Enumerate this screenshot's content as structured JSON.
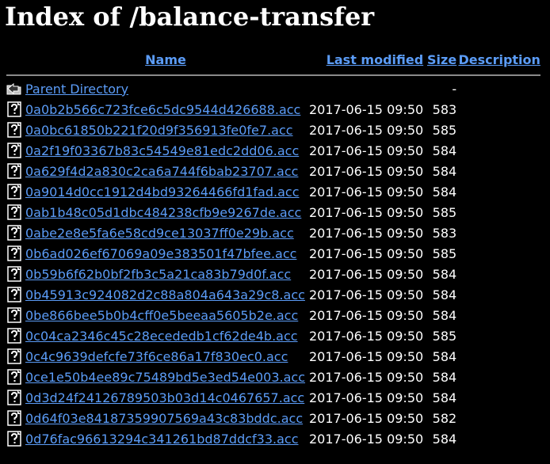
{
  "title": "Index of /balance-transfer",
  "columns": {
    "name": "Name",
    "last_modified": "Last modified",
    "size": "Size",
    "description": "Description"
  },
  "parent": {
    "label": "Parent Directory",
    "size": "-",
    "icon": "back-folder-icon"
  },
  "files": [
    {
      "name": "0a0b2b566c723fce6c5dc9544d426688.acc",
      "modified": "2017-06-15 09:50",
      "size": "583",
      "icon": "unknown-file-icon"
    },
    {
      "name": "0a0bc61850b221f20d9f356913fe0fe7.acc",
      "modified": "2017-06-15 09:50",
      "size": "585",
      "icon": "unknown-file-icon"
    },
    {
      "name": "0a2f19f03367b83c54549e81edc2dd06.acc",
      "modified": "2017-06-15 09:50",
      "size": "584",
      "icon": "unknown-file-icon"
    },
    {
      "name": "0a629f4d2a830c2ca6a744f6bab23707.acc",
      "modified": "2017-06-15 09:50",
      "size": "584",
      "icon": "unknown-file-icon"
    },
    {
      "name": "0a9014d0cc1912d4bd93264466fd1fad.acc",
      "modified": "2017-06-15 09:50",
      "size": "584",
      "icon": "unknown-file-icon"
    },
    {
      "name": "0ab1b48c05d1dbc484238cfb9e9267de.acc",
      "modified": "2017-06-15 09:50",
      "size": "585",
      "icon": "unknown-file-icon"
    },
    {
      "name": "0abe2e8e5fa6e58cd9ce13037ff0e29b.acc",
      "modified": "2017-06-15 09:50",
      "size": "583",
      "icon": "unknown-file-icon"
    },
    {
      "name": "0b6ad026ef67069a09e383501f47bfee.acc",
      "modified": "2017-06-15 09:50",
      "size": "585",
      "icon": "unknown-file-icon"
    },
    {
      "name": "0b59b6f62b0bf2fb3c5a21ca83b79d0f.acc",
      "modified": "2017-06-15 09:50",
      "size": "584",
      "icon": "unknown-file-icon"
    },
    {
      "name": "0b45913c924082d2c88a804a643a29c8.acc",
      "modified": "2017-06-15 09:50",
      "size": "584",
      "icon": "unknown-file-icon"
    },
    {
      "name": "0be866bee5b0b4cff0e5beeaa5605b2e.acc",
      "modified": "2017-06-15 09:50",
      "size": "584",
      "icon": "unknown-file-icon"
    },
    {
      "name": "0c04ca2346c45c28ecededb1cf62de4b.acc",
      "modified": "2017-06-15 09:50",
      "size": "585",
      "icon": "unknown-file-icon"
    },
    {
      "name": "0c4c9639defcfe73f6ce86a17f830ec0.acc",
      "modified": "2017-06-15 09:50",
      "size": "584",
      "icon": "unknown-file-icon"
    },
    {
      "name": "0ce1e50b4ee89c75489bd5e3ed54e003.acc",
      "modified": "2017-06-15 09:50",
      "size": "584",
      "icon": "unknown-file-icon"
    },
    {
      "name": "0d3d24f24126789503b03d14c0467657.acc",
      "modified": "2017-06-15 09:50",
      "size": "584",
      "icon": "unknown-file-icon"
    },
    {
      "name": "0d64f03e84187359907569a43c83bddc.acc",
      "modified": "2017-06-15 09:50",
      "size": "582",
      "icon": "unknown-file-icon"
    },
    {
      "name": "0d76fac96613294c341261bd87ddcf33.acc",
      "modified": "2017-06-15 09:50",
      "size": "584",
      "icon": "unknown-file-icon"
    }
  ],
  "colors": {
    "background": "#000000",
    "text": "#ffffff",
    "link": "#5b9cf7",
    "rule": "#8a8a8a"
  }
}
